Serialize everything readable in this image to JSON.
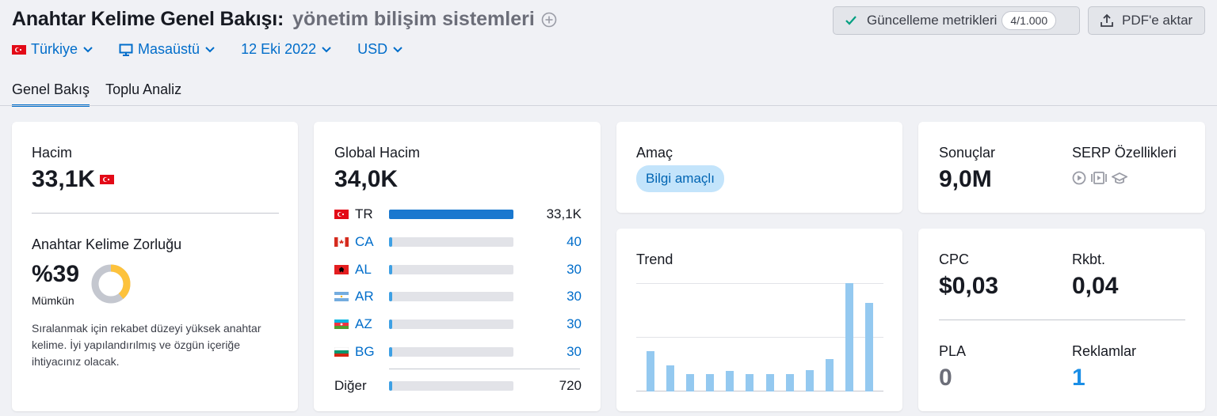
{
  "header": {
    "title": "Anahtar Kelime Genel Bakışı:",
    "keyword": "yönetim bilişim sistemleri",
    "update_button": "Güncelleme metrikleri",
    "update_badge": "4/1.000",
    "pdf_button": "PDF'e aktar"
  },
  "filters": {
    "country": "Türkiye",
    "device": "Masaüstü",
    "date": "12 Eki 2022",
    "currency": "USD"
  },
  "tabs": [
    {
      "label": "Genel Bakış",
      "active": true
    },
    {
      "label": "Toplu Analiz",
      "active": false
    }
  ],
  "volume": {
    "label": "Hacim",
    "value": "33,1K",
    "kd_label": "Anahtar Kelime Zorluğu",
    "kd_value": "%39",
    "kd_level": "Mümkün",
    "kd_percent": 39,
    "description": "Sıralanmak için rekabet düzeyi yüksek anahtar kelime. İyi yapılandırılmış ve özgün içeriğe ihtiyacınız olacak."
  },
  "global_volume": {
    "label": "Global Hacim",
    "value": "34,0K",
    "rows": [
      {
        "code": "TR",
        "value": "33,1K",
        "share": 1.0
      },
      {
        "code": "CA",
        "value": "40",
        "share": 0.025
      },
      {
        "code": "AL",
        "value": "30",
        "share": 0.025
      },
      {
        "code": "AR",
        "value": "30",
        "share": 0.025
      },
      {
        "code": "AZ",
        "value": "30",
        "share": 0.025
      },
      {
        "code": "BG",
        "value": "30",
        "share": 0.025
      }
    ],
    "other": {
      "label": "Diğer",
      "value": "720",
      "share": 0.025
    }
  },
  "intent": {
    "label": "Amaç",
    "value": "Bilgi amaçlı"
  },
  "trend": {
    "label": "Trend",
    "values": [
      0.37,
      0.24,
      0.16,
      0.16,
      0.19,
      0.16,
      0.16,
      0.16,
      0.2,
      0.3,
      1.0,
      0.82
    ]
  },
  "results": {
    "label": "Sonuçlar",
    "value": "9,0M",
    "serp_label": "SERP Özellikleri",
    "serp_icons": [
      "video-icon",
      "video-carousel-icon",
      "knowledge-panel-icon"
    ]
  },
  "ads": {
    "cpc_label": "CPC",
    "cpc_value": "$0,03",
    "comp_label": "Rkbt.",
    "comp_value": "0,04",
    "pla_label": "PLA",
    "pla_value": "0",
    "ads_label": "Reklamlar",
    "ads_value": "1"
  },
  "colors": {
    "accent": "#006dca",
    "kd_fill": "#fdc23c",
    "kd_track": "#c4c7cf",
    "trend_bar": "#94c9f0"
  }
}
